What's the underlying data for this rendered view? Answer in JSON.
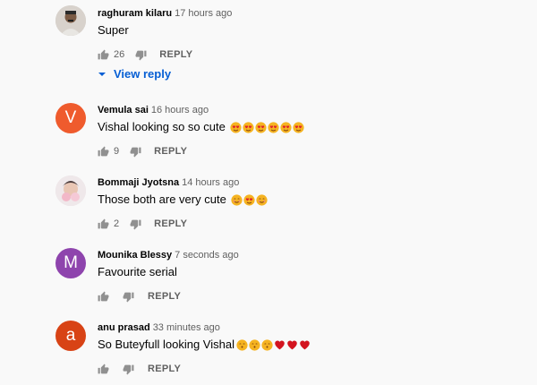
{
  "comments": [
    {
      "author": "raghuram kilaru",
      "time": "17 hours ago",
      "text": "Super",
      "likes": "26",
      "reply_label": "REPLY",
      "avatar_type": "photo",
      "emojis": []
    },
    {
      "author": "Vemula sai",
      "time": "16 hours ago",
      "text": "Vishal looking so so cute",
      "likes": "9",
      "reply_label": "REPLY",
      "avatar_letter": "V",
      "avatar_color": "#ef5b2d",
      "emojis": [
        "heart-eyes",
        "heart-eyes",
        "heart-eyes",
        "heart-eyes",
        "heart-eyes",
        "heart-eyes"
      ]
    },
    {
      "author": "Bommaji Jyotsna",
      "time": "14 hours ago",
      "text": "Those both are very cute",
      "likes": "2",
      "reply_label": "REPLY",
      "avatar_type": "photo",
      "emojis": [
        "smiling-face",
        "heart-eyes",
        "smiling-face"
      ]
    },
    {
      "author": "Mounika Blessy",
      "time": "7 seconds ago",
      "text": "Favourite serial",
      "likes": "",
      "reply_label": "REPLY",
      "avatar_letter": "M",
      "avatar_color": "#8e44ad",
      "emojis": []
    },
    {
      "author": "anu prasad",
      "time": "33 minutes ago",
      "text": "So Buteyfull looking Vishal",
      "likes": "",
      "reply_label": "REPLY",
      "avatar_letter": "a",
      "avatar_color": "#d84315",
      "emojis": [
        "kissing-face",
        "kissing-face",
        "kissing-face",
        "red-heart",
        "red-heart",
        "red-heart"
      ]
    }
  ],
  "view_reply_label": "View reply",
  "colors": {
    "link": "#065fd4",
    "meta": "#606060"
  }
}
